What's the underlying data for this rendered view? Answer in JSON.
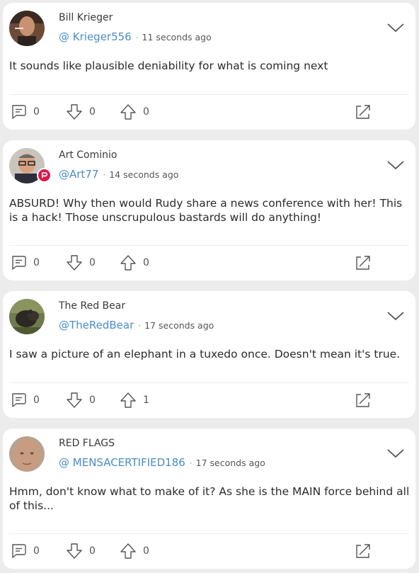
{
  "posts": [
    {
      "name": "Bill Krieger",
      "handle": "@ Krieger556",
      "separator": "·",
      "time": "11 seconds ago",
      "text": "It sounds like plausible deniability for what is coming next",
      "comments": "0",
      "downvotes": "0",
      "upvotes": "0",
      "avatar": "man-smoking-photo"
    },
    {
      "name": "Art Cominio",
      "handle": "@Art77",
      "separator": "·",
      "time": "14 seconds ago",
      "text": "ABSURD! Why then would Rudy share a news conference with her! This is a hack! Those unscrupulous bastards will do anything!",
      "comments": "0",
      "downvotes": "0",
      "upvotes": "0",
      "avatar": "man-glasses-photo",
      "badge": "parler-badge"
    },
    {
      "name": "The Red Bear",
      "handle": "@TheRedBear",
      "separator": "·",
      "time": "17 seconds ago",
      "text": "I saw a picture of an elephant in a tuxedo once. Doesn't mean it's true.",
      "comments": "0",
      "downvotes": "0",
      "upvotes": "1",
      "avatar": "bear-photo"
    },
    {
      "name": "RED FLAGS",
      "handle": "@ MENSACERTIFIED186",
      "separator": "·",
      "time": "17 seconds ago",
      "text": "Hmm, don't know what to make of it? As she is the MAIN force behind all of this...",
      "comments": "0",
      "downvotes": "0",
      "upvotes": "0",
      "avatar": "bald-man-photo"
    }
  ],
  "icons": {
    "comment": "comment-icon",
    "downvote": "downvote-icon",
    "upvote": "upvote-icon",
    "expand": "expand-icon",
    "menu": "chevron-down-icon"
  },
  "colors": {
    "handle": "#4a8cc8",
    "badge": "#d61c4e",
    "card": "#ffffff",
    "background": "#ececec"
  }
}
